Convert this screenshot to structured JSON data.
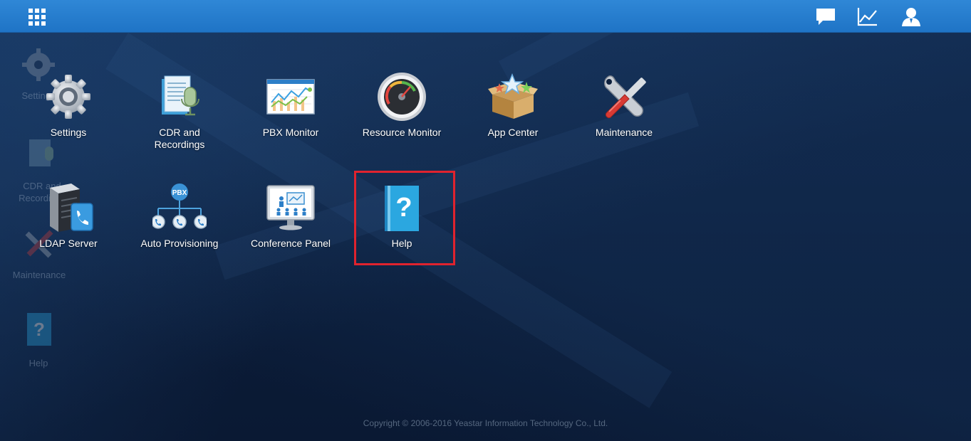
{
  "topbar": {
    "menu_icon": "grid-menu-icon",
    "icons": [
      "chat-bubble-icon",
      "line-chart-icon",
      "user-icon"
    ],
    "color": "#2479ca"
  },
  "background_ghosts": [
    {
      "label": "Settings"
    },
    {
      "label": "CDR and Recordings"
    },
    {
      "label": "Maintenance"
    },
    {
      "label": "Help"
    }
  ],
  "apps": [
    {
      "id": "settings",
      "label": "Settings",
      "icon": "gear-icon"
    },
    {
      "id": "cdr",
      "label": "CDR and Recordings",
      "icon": "cdr-recordings-icon"
    },
    {
      "id": "pbx-monitor",
      "label": "PBX Monitor",
      "icon": "pbx-monitor-icon"
    },
    {
      "id": "resource-monitor",
      "label": "Resource Monitor",
      "icon": "gauge-icon"
    },
    {
      "id": "app-center",
      "label": "App Center",
      "icon": "box-stars-icon"
    },
    {
      "id": "maintenance",
      "label": "Maintenance",
      "icon": "wrench-screwdriver-icon"
    },
    {
      "id": "ldap",
      "label": "LDAP Server",
      "icon": "server-phone-icon"
    },
    {
      "id": "auto-provisioning",
      "label": "Auto Provisioning",
      "icon": "pbx-tree-icon",
      "badge": "PBX"
    },
    {
      "id": "conference",
      "label": "Conference Panel",
      "icon": "conference-monitor-icon"
    },
    {
      "id": "help",
      "label": "Help",
      "icon": "help-book-icon",
      "highlighted": true
    }
  ],
  "highlight_color": "#e0232e",
  "footer": {
    "copyright": "Copyright © 2006-2016 Yeastar Information Technology Co., Ltd."
  }
}
